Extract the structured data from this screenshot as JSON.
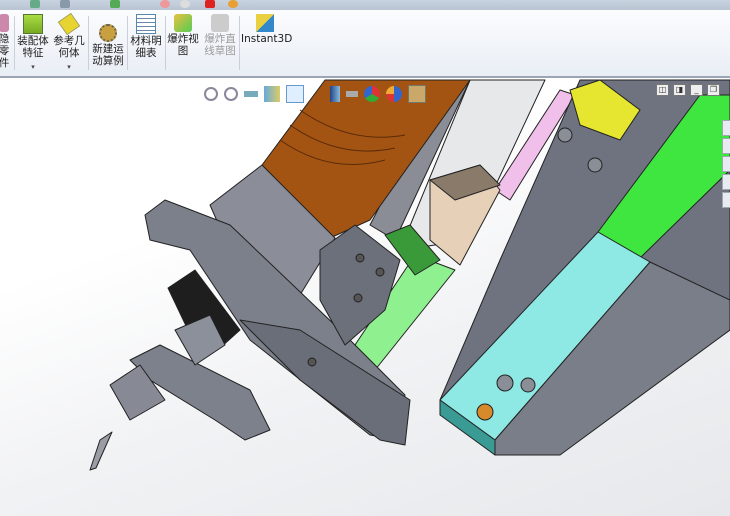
{
  "ribbon": {
    "items": [
      {
        "label_lines": [
          "隐",
          "零",
          "件"
        ],
        "icon": "show-hidden-components-icon",
        "disabled": false
      },
      {
        "label_lines": [
          "装配体",
          "特征"
        ],
        "icon": "assembly-features-icon",
        "has_dropdown": true
      },
      {
        "label_lines": [
          "参考几",
          "何体"
        ],
        "icon": "reference-geometry-icon",
        "has_dropdown": true
      },
      {
        "label_lines": [
          "新建运",
          "动算例"
        ],
        "icon": "new-motion-study-icon"
      },
      {
        "label_lines": [
          "材料明",
          "细表"
        ],
        "icon": "bill-of-materials-icon"
      },
      {
        "label_lines": [
          "爆炸视",
          "图"
        ],
        "icon": "exploded-view-icon"
      },
      {
        "label_lines": [
          "爆炸直",
          "线草图"
        ],
        "icon": "explode-line-sketch-icon",
        "disabled": true
      },
      {
        "label_lines": [
          "Instant3D"
        ],
        "icon": "instant3d-icon"
      }
    ],
    "dropdown_glyph": "▾"
  },
  "heads_up_toolbar": [
    "zoom-to-fit-icon",
    "zoom-to-area-icon",
    "previous-view-icon",
    "section-view-icon",
    "view-orientation-icon",
    "display-style-icon",
    "hide-show-items-icon",
    "edit-appearance-icon",
    "apply-scene-icon",
    "view-settings-icon"
  ],
  "window_controls": [
    "◫",
    "◨",
    "_",
    "❐"
  ],
  "colors": {
    "motor": "#a35412",
    "plate": "#6f7380",
    "green": "#3fe63f",
    "cyan": "#8ee8e4",
    "yellow": "#e6e630",
    "pink": "#f0c0ea",
    "light_green": "#8ef08e"
  }
}
